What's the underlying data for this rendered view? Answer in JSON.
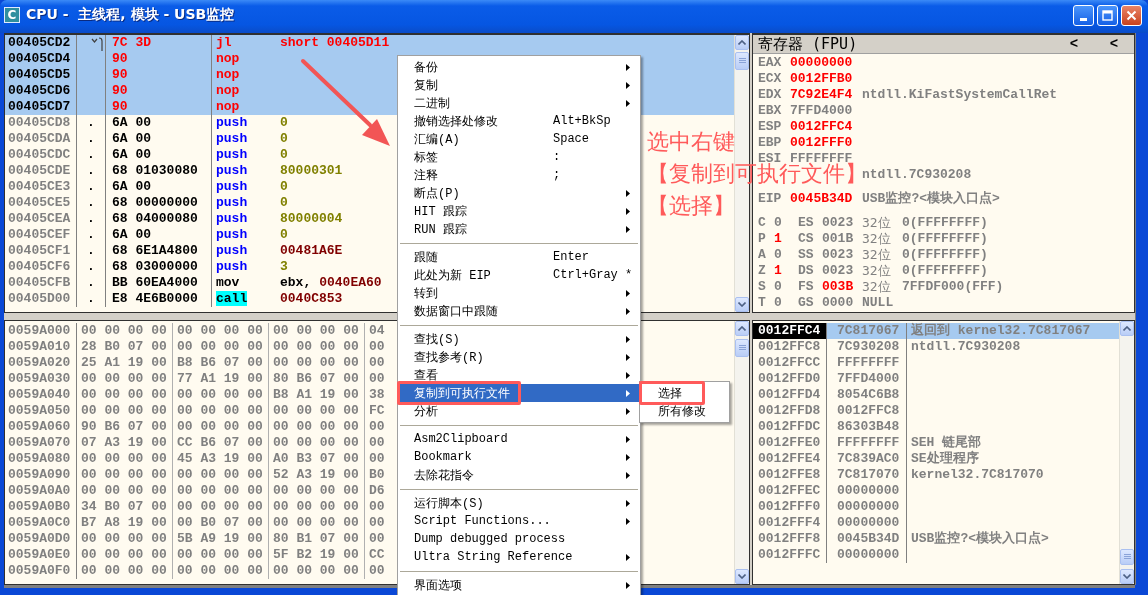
{
  "window": {
    "icon_label": "C",
    "title": "CPU -  主线程, 模块 - USB监控"
  },
  "disassembly": {
    "rows": [
      {
        "address": "00405CD2",
        "selected": true,
        "modified": true,
        "jump": true,
        "hex": "7C 3D",
        "mnemonic": "jl",
        "kind": "plain",
        "operands": [
          {
            "text": "short 00405D11",
            "kind": "address"
          }
        ]
      },
      {
        "address": "00405CD4",
        "selected": true,
        "modified": true,
        "jump": false,
        "hex": "90",
        "mnemonic": "nop",
        "kind": "plain"
      },
      {
        "address": "00405CD5",
        "selected": true,
        "modified": true,
        "jump": false,
        "hex": "90",
        "mnemonic": "nop",
        "kind": "plain"
      },
      {
        "address": "00405CD6",
        "selected": true,
        "modified": true,
        "jump": false,
        "hex": "90",
        "mnemonic": "nop",
        "kind": "plain"
      },
      {
        "address": "00405CD7",
        "selected": true,
        "modified": true,
        "jump": false,
        "hex": "90",
        "mnemonic": "nop",
        "kind": "plain"
      },
      {
        "address": "00405CD8",
        "selected": false,
        "modified": false,
        "jump": false,
        "marker": ".",
        "hex": "6A 00",
        "mnemonic": "push",
        "kind": "stack",
        "operands": [
          {
            "text": "0",
            "kind": "const"
          }
        ]
      },
      {
        "address": "00405CDA",
        "selected": false,
        "modified": false,
        "jump": false,
        "marker": ".",
        "hex": "6A 00",
        "mnemonic": "push",
        "kind": "stack",
        "operands": [
          {
            "text": "0",
            "kind": "const"
          }
        ]
      },
      {
        "address": "00405CDC",
        "selected": false,
        "modified": false,
        "jump": false,
        "marker": ".",
        "hex": "6A 00",
        "mnemonic": "push",
        "kind": "stack",
        "operands": [
          {
            "text": "0",
            "kind": "const"
          }
        ]
      },
      {
        "address": "00405CDE",
        "selected": false,
        "modified": false,
        "jump": false,
        "marker": ".",
        "hex": "68 01030080",
        "mnemonic": "push",
        "kind": "stack",
        "operands": [
          {
            "text": "80000301",
            "kind": "const"
          }
        ]
      },
      {
        "address": "00405CE3",
        "selected": false,
        "modified": false,
        "jump": false,
        "marker": ".",
        "hex": "6A 00",
        "mnemonic": "push",
        "kind": "stack",
        "operands": [
          {
            "text": "0",
            "kind": "const"
          }
        ]
      },
      {
        "address": "00405CE5",
        "selected": false,
        "modified": false,
        "jump": false,
        "marker": ".",
        "hex": "68 00000000",
        "mnemonic": "push",
        "kind": "stack",
        "operands": [
          {
            "text": "0",
            "kind": "const"
          }
        ]
      },
      {
        "address": "00405CEA",
        "selected": false,
        "modified": false,
        "jump": false,
        "marker": ".",
        "hex": "68 04000080",
        "mnemonic": "push",
        "kind": "stack",
        "operands": [
          {
            "text": "80000004",
            "kind": "const"
          }
        ]
      },
      {
        "address": "00405CEF",
        "selected": false,
        "modified": false,
        "jump": false,
        "marker": ".",
        "hex": "6A 00",
        "mnemonic": "push",
        "kind": "stack",
        "operands": [
          {
            "text": "0",
            "kind": "const"
          }
        ]
      },
      {
        "address": "00405CF1",
        "selected": false,
        "modified": false,
        "jump": false,
        "marker": ".",
        "hex": "68 6E1A4800",
        "mnemonic": "push",
        "kind": "stack",
        "operands": [
          {
            "text": "00481A6E",
            "kind": "address"
          }
        ]
      },
      {
        "address": "00405CF6",
        "selected": false,
        "modified": false,
        "jump": false,
        "marker": ".",
        "hex": "68 03000000",
        "mnemonic": "push",
        "kind": "stack",
        "operands": [
          {
            "text": "3",
            "kind": "const"
          }
        ]
      },
      {
        "address": "00405CFB",
        "selected": false,
        "modified": false,
        "jump": false,
        "marker": ".",
        "hex": "BB 60EA4000",
        "mnemonic": "mov",
        "kind": "plain",
        "operands": [
          {
            "text": "ebx,",
            "kind": "register"
          },
          {
            "text": "0040EA60",
            "kind": "address"
          }
        ]
      },
      {
        "address": "00405D00",
        "selected": false,
        "modified": false,
        "jump": false,
        "marker": ".",
        "hex": "E8 4E6B0000",
        "mnemonic": "call",
        "kind": "call",
        "operands": [
          {
            "text": "0040C853",
            "kind": "address"
          }
        ]
      }
    ]
  },
  "dump": {
    "rows": [
      {
        "address": "0059A000",
        "groups": [
          "00 00 00 00",
          "00 00 00 00",
          "00 00 00 00",
          "04"
        ]
      },
      {
        "address": "0059A010",
        "groups": [
          "28 B0 07 00",
          "00 00 00 00",
          "00 00 00 00",
          "00"
        ]
      },
      {
        "address": "0059A020",
        "groups": [
          "25 A1 19 00",
          "B8 B6 07 00",
          "00 00 00 00",
          "00"
        ]
      },
      {
        "address": "0059A030",
        "groups": [
          "00 00 00 00",
          "77 A1 19 00",
          "80 B6 07 00",
          "00"
        ]
      },
      {
        "address": "0059A040",
        "groups": [
          "00 00 00 00",
          "00 00 00 00",
          "B8 A1 19 00",
          "38"
        ]
      },
      {
        "address": "0059A050",
        "groups": [
          "00 00 00 00",
          "00 00 00 00",
          "00 00 00 00",
          "FC"
        ]
      },
      {
        "address": "0059A060",
        "groups": [
          "90 B6 07 00",
          "00 00 00 00",
          "00 00 00 00",
          "00"
        ]
      },
      {
        "address": "0059A070",
        "groups": [
          "07 A3 19 00",
          "CC B6 07 00",
          "00 00 00 00",
          "00"
        ]
      },
      {
        "address": "0059A080",
        "groups": [
          "00 00 00 00",
          "45 A3 19 00",
          "A0 B3 07 00",
          "00"
        ]
      },
      {
        "address": "0059A090",
        "groups": [
          "00 00 00 00",
          "00 00 00 00",
          "52 A3 19 00",
          "B0"
        ]
      },
      {
        "address": "0059A0A0",
        "groups": [
          "00 00 00 00",
          "00 00 00 00",
          "00 00 00 00",
          "D6"
        ]
      },
      {
        "address": "0059A0B0",
        "groups": [
          "34 B0 07 00",
          "00 00 00 00",
          "00 00 00 00",
          "00"
        ]
      },
      {
        "address": "0059A0C0",
        "groups": [
          "B7 A8 19 00",
          "00 B0 07 00",
          "00 00 00 00",
          "00"
        ]
      },
      {
        "address": "0059A0D0",
        "groups": [
          "00 00 00 00",
          "5B A9 19 00",
          "80 B1 07 00",
          "00"
        ]
      },
      {
        "address": "0059A0E0",
        "groups": [
          "00 00 00 00",
          "00 00 00 00",
          "5F B2 19 00",
          "CC"
        ]
      },
      {
        "address": "0059A0F0",
        "groups": [
          "00 00 00 00",
          "00 00 00 00",
          "00 00 00 00",
          "00"
        ]
      }
    ]
  },
  "registers": {
    "title": "寄存器 (FPU)",
    "header_buttons": [
      "<",
      "<"
    ],
    "groups": [
      [
        {
          "name": "EAX",
          "value": "00000000",
          "changed": true
        },
        {
          "name": "ECX",
          "value": "0012FFB0",
          "changed": true
        },
        {
          "name": "EDX",
          "value": "7C92E4F4",
          "changed": true,
          "comment": "ntdll.KiFastSystemCallRet"
        },
        {
          "name": "EBX",
          "value": "7FFD4000",
          "changed": false
        },
        {
          "name": "ESP",
          "value": "0012FFC4",
          "changed": true
        },
        {
          "name": "EBP",
          "value": "0012FFF0",
          "changed": true
        },
        {
          "name": "ESI",
          "value": "FFFFFFFF",
          "changed": false
        },
        {
          "comment": "ntdll.7C930208"
        }
      ],
      [
        {
          "name": "EIP",
          "value": "0045B34D",
          "changed": true,
          "comment": "USB监控?<模块入口点>"
        }
      ]
    ],
    "flags": [
      {
        "flag": "C",
        "value": "0",
        "changed": false,
        "segment": "ES",
        "selector": "0023",
        "selector_changed": false,
        "bits": "32位",
        "base": "0(FFFFFFFF)"
      },
      {
        "flag": "P",
        "value": "1",
        "changed": true,
        "segment": "CS",
        "selector": "001B",
        "selector_changed": false,
        "bits": "32位",
        "base": "0(FFFFFFFF)"
      },
      {
        "flag": "A",
        "value": "0",
        "changed": false,
        "segment": "SS",
        "selector": "0023",
        "selector_changed": false,
        "bits": "32位",
        "base": "0(FFFFFFFF)"
      },
      {
        "flag": "Z",
        "value": "1",
        "changed": true,
        "segment": "DS",
        "selector": "0023",
        "selector_changed": false,
        "bits": "32位",
        "base": "0(FFFFFFFF)"
      },
      {
        "flag": "S",
        "value": "0",
        "changed": false,
        "segment": "FS",
        "selector": "003B",
        "selector_changed": true,
        "bits": "32位",
        "base": "7FFDF000(FFF)"
      },
      {
        "flag": "T",
        "value": "0",
        "changed": false,
        "segment": "GS",
        "selector": "0000",
        "selector_changed": false,
        "base": "NULL"
      }
    ]
  },
  "stack": {
    "rows": [
      {
        "address": "0012FFC4",
        "value": "7C817067",
        "comment": "返回到 kernel32.7C817067",
        "selected": true
      },
      {
        "address": "0012FFC8",
        "value": "7C930208",
        "comment": "ntdll.7C930208",
        "selected": false
      },
      {
        "address": "0012FFCC",
        "value": "FFFFFFFF",
        "selected": false
      },
      {
        "address": "0012FFD0",
        "value": "7FFD4000",
        "selected": false
      },
      {
        "address": "0012FFD4",
        "value": "8054C6B8",
        "selected": false
      },
      {
        "address": "0012FFD8",
        "value": "0012FFC8",
        "selected": false
      },
      {
        "address": "0012FFDC",
        "value": "86303B48",
        "selected": false
      },
      {
        "address": "0012FFE0",
        "value": "FFFFFFFF",
        "comment": "SEH 链尾部",
        "selected": false
      },
      {
        "address": "0012FFE4",
        "value": "7C839AC0",
        "comment": "SE处理程序",
        "selected": false
      },
      {
        "address": "0012FFE8",
        "value": "7C817070",
        "comment": "kernel32.7C817070",
        "selected": false
      },
      {
        "address": "0012FFEC",
        "value": "00000000",
        "selected": false
      },
      {
        "address": "0012FFF0",
        "value": "00000000",
        "selected": false
      },
      {
        "address": "0012FFF4",
        "value": "00000000",
        "selected": false
      },
      {
        "address": "0012FFF8",
        "value": "0045B34D",
        "comment": "USB监控?<模块入口点>",
        "selected": false
      },
      {
        "address": "0012FFFC",
        "value": "00000000",
        "selected": false
      }
    ]
  },
  "context_menu": {
    "items": [
      {
        "kind": "item",
        "label": "备份",
        "submenu": true,
        "selected": false,
        "boxed": false
      },
      {
        "kind": "item",
        "label": "复制",
        "submenu": true,
        "selected": false,
        "boxed": false
      },
      {
        "kind": "item",
        "label": "二进制",
        "submenu": true,
        "selected": false,
        "boxed": false
      },
      {
        "kind": "item",
        "label": "撤销选择处修改",
        "shortcut": "Alt+BkSp",
        "submenu": false,
        "selected": false,
        "boxed": false
      },
      {
        "kind": "item",
        "label": "汇编(A)",
        "shortcut": "Space",
        "submenu": false,
        "selected": false,
        "boxed": false
      },
      {
        "kind": "item",
        "label": "标签",
        "shortcut": ":",
        "submenu": false,
        "selected": false,
        "boxed": false
      },
      {
        "kind": "item",
        "label": "注释",
        "shortcut": ";",
        "submenu": false,
        "selected": false,
        "boxed": false
      },
      {
        "kind": "item",
        "label": "断点(P)",
        "submenu": true,
        "selected": false,
        "boxed": false
      },
      {
        "kind": "item",
        "label": "HIT 跟踪",
        "submenu": true,
        "selected": false,
        "boxed": false
      },
      {
        "kind": "item",
        "label": "RUN 跟踪",
        "submenu": true,
        "selected": false,
        "boxed": false
      },
      {
        "kind": "separator"
      },
      {
        "kind": "item",
        "label": "跟随",
        "shortcut": "Enter",
        "submenu": false,
        "selected": false,
        "boxed": false
      },
      {
        "kind": "item",
        "label": "此处为新 EIP",
        "shortcut": "Ctrl+Gray *",
        "submenu": false,
        "selected": false,
        "boxed": false
      },
      {
        "kind": "item",
        "label": "转到",
        "submenu": true,
        "selected": false,
        "boxed": false
      },
      {
        "kind": "item",
        "label": "数据窗口中跟随",
        "submenu": true,
        "selected": false,
        "boxed": false
      },
      {
        "kind": "separator"
      },
      {
        "kind": "item",
        "label": "查找(S)",
        "submenu": true,
        "selected": false,
        "boxed": false
      },
      {
        "kind": "item",
        "label": "查找参考(R)",
        "submenu": true,
        "selected": false,
        "boxed": false
      },
      {
        "kind": "item",
        "label": "查看",
        "submenu": true,
        "selected": false,
        "boxed": false
      },
      {
        "kind": "item",
        "label": "复制到可执行文件",
        "submenu": true,
        "selected": true,
        "boxed": true,
        "children": [
          {
            "label": "选择",
            "selected": false,
            "boxed": true
          },
          {
            "label": "所有修改",
            "selected": false,
            "boxed": false
          }
        ]
      },
      {
        "kind": "item",
        "label": "分析",
        "submenu": true,
        "selected": false,
        "boxed": false
      },
      {
        "kind": "separator"
      },
      {
        "kind": "item",
        "label": "Asm2Clipboard",
        "submenu": true,
        "selected": false,
        "boxed": false
      },
      {
        "kind": "item",
        "label": "Bookmark",
        "submenu": true,
        "selected": false,
        "boxed": false
      },
      {
        "kind": "item",
        "label": "去除花指令",
        "submenu": true,
        "selected": false,
        "boxed": false
      },
      {
        "kind": "separator"
      },
      {
        "kind": "item",
        "label": "运行脚本(S)",
        "submenu": true,
        "selected": false,
        "boxed": false
      },
      {
        "kind": "item",
        "label": "Script Functions...",
        "submenu": true,
        "selected": false,
        "boxed": false
      },
      {
        "kind": "item",
        "label": "Dump debugged process",
        "submenu": false,
        "selected": false,
        "boxed": false
      },
      {
        "kind": "item",
        "label": "Ultra String Reference",
        "submenu": true,
        "selected": false,
        "boxed": false
      },
      {
        "kind": "separator"
      },
      {
        "kind": "item",
        "label": "界面选项",
        "submenu": true,
        "selected": false,
        "boxed": false
      }
    ]
  },
  "annotation": {
    "lines": [
      "选中右键",
      "【复制到可执行文件】",
      "【选择】"
    ]
  }
}
